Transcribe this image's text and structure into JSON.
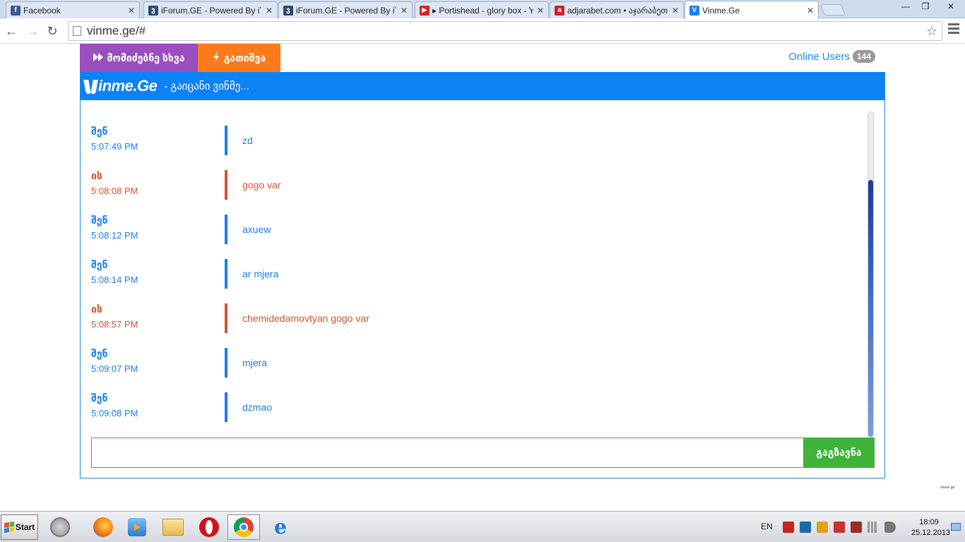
{
  "browser": {
    "tabs": [
      {
        "title": "Facebook",
        "favicon_color": "#3b5998",
        "favicon_glyph": "f",
        "active": false
      },
      {
        "title": "iForum.GE - Powered By iT",
        "favicon_color": "#2c4a6e",
        "favicon_glyph": "ვ",
        "active": false
      },
      {
        "title": "iForum.GE - Powered By iT",
        "favicon_color": "#2c4a6e",
        "favicon_glyph": "ვ",
        "active": false
      },
      {
        "title": "▸ Portishead - glory box - Yo",
        "favicon_color": "#e02020",
        "favicon_glyph": "▶",
        "active": false
      },
      {
        "title": "adjarabet.com • აჯარაბეთ ·",
        "favicon_color": "#d0202a",
        "favicon_glyph": "a",
        "active": false
      },
      {
        "title": "Vinme.Ge",
        "favicon_color": "#1a7ef0",
        "favicon_glyph": "V",
        "active": true
      }
    ],
    "close_glyph": "✕",
    "window_controls": {
      "minimize": "—",
      "restore": "❐",
      "close": "✕"
    },
    "nav": {
      "back": "←",
      "forward": "→",
      "reload": "↻"
    },
    "url": "vinme.ge/#",
    "star": "☆"
  },
  "site": {
    "nav_next_label": "მომიძებნე სხვა",
    "nav_next_icon": "fast-forward-icon",
    "nav_stop_label": "გათიშვა",
    "nav_stop_icon": "lightning-icon",
    "online_label": "Online Users",
    "online_count": "144",
    "logo_text": "inme.Ge",
    "tagline": "- გაიცანი ვინმე...",
    "colors": {
      "me": "#1a7ef0",
      "them": "#d8502f",
      "brand": "#0d82f5",
      "next": "#9b4fbf",
      "stop": "#ff7a1a",
      "send": "#3fb33a"
    },
    "messages": [
      {
        "sender": "შენ",
        "time": "5:07:49 PM",
        "text": "zd",
        "side": "me"
      },
      {
        "sender": "ის",
        "time": "5:08:08 PM",
        "text": "gogo var",
        "side": "them"
      },
      {
        "sender": "შენ",
        "time": "5:08:12 PM",
        "text": "axuew",
        "side": "me"
      },
      {
        "sender": "შენ",
        "time": "5:08:14 PM",
        "text": "ar mjera",
        "side": "me"
      },
      {
        "sender": "ის",
        "time": "5:08:57 PM",
        "text": "chemidedamovtyan gogo var",
        "side": "them"
      },
      {
        "sender": "შენ",
        "time": "5:09:07 PM",
        "text": "mjera",
        "side": "me"
      },
      {
        "sender": "შენ",
        "time": "5:09:08 PM",
        "text": "dzmao",
        "side": "me"
      }
    ],
    "input_value": "",
    "send_label": "გაგზავნა",
    "footer_tiny": "vinme.ge"
  },
  "taskbar": {
    "start_label": "Start",
    "apps": [
      "circle-app-icon",
      "firefox-icon",
      "media-player-icon",
      "folder-icon",
      "opera-icon",
      "chrome-icon",
      "internet-explorer-icon"
    ],
    "language": "EN",
    "time": "18:09",
    "date": "25.12.2013"
  }
}
